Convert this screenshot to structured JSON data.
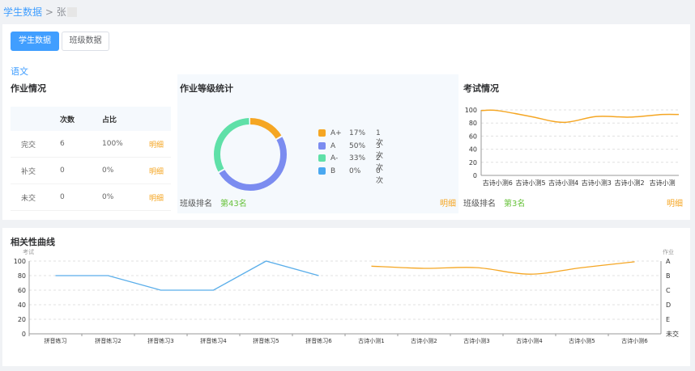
{
  "breadcrumb": {
    "parent": "学生数据",
    "separator": ">",
    "current": "张"
  },
  "tabs": {
    "student": "学生数据",
    "class": "班级数据"
  },
  "subject": "语文",
  "homework": {
    "title": "作业情况",
    "headers": [
      "",
      "次数",
      "占比",
      ""
    ],
    "rows": [
      {
        "label": "完交",
        "count": "6",
        "ratio": "100%",
        "action": "明细"
      },
      {
        "label": "补交",
        "count": "0",
        "ratio": "0%",
        "action": "明细"
      },
      {
        "label": "未交",
        "count": "0",
        "ratio": "0%",
        "action": "明细"
      }
    ]
  },
  "grades": {
    "title": "作业等级统计",
    "legend": [
      {
        "grade": "A+",
        "percent": "17%",
        "count": "1次",
        "color": "#f5a623"
      },
      {
        "grade": "A",
        "percent": "50%",
        "count": "3次",
        "color": "#7b8cf0"
      },
      {
        "grade": "A-",
        "percent": "33%",
        "count": "2次",
        "color": "#5fe0a8"
      },
      {
        "grade": "B",
        "percent": "0%",
        "count": "0次",
        "color": "#4aa8f0"
      }
    ],
    "rank_label": "班级排名",
    "rank_value": "第43名",
    "detail": "明细"
  },
  "exams": {
    "title": "考试情况",
    "rank_label": "班级排名",
    "rank_value": "第3名",
    "detail": "明细"
  },
  "correlation": {
    "title": "相关性曲线"
  },
  "chart_data": [
    {
      "type": "line",
      "title": "考试情况",
      "categories": [
        "古诗小测6",
        "古诗小测5",
        "古诗小测4",
        "古诗小测3",
        "古诗小测2",
        "古诗小测"
      ],
      "series": [
        {
          "values": [
            99,
            90,
            81,
            90,
            89,
            93
          ],
          "color": "#f5a623"
        }
      ],
      "yticks": [
        "0",
        "20",
        "40",
        "60",
        "80",
        "100"
      ],
      "ylim": [
        0,
        100
      ],
      "grid": true
    },
    {
      "type": "line",
      "title": "相关性曲线",
      "left_axis_label": "考试",
      "right_axis_label": "作业",
      "categories": [
        "拼音练习",
        "拼音练习2",
        "拼音练习3",
        "拼音练习4",
        "拼音练习5",
        "拼音练习6",
        "古诗小测1",
        "古诗小测2",
        "古诗小测3",
        "古诗小测4",
        "古诗小测5",
        "古诗小测6"
      ],
      "yticks_left": [
        "0",
        "20",
        "40",
        "60",
        "80",
        "100"
      ],
      "yticks_right": [
        "未交",
        "E",
        "D",
        "C",
        "B",
        "A"
      ],
      "ylim": [
        0,
        100
      ],
      "grid": true,
      "series": [
        {
          "axis": "right",
          "color": "#5aaeea",
          "values": [
            80,
            80,
            60,
            60,
            100,
            80,
            null,
            null,
            null,
            null,
            null,
            null
          ]
        },
        {
          "axis": "left",
          "color": "#f5a623",
          "values": [
            null,
            null,
            null,
            null,
            null,
            null,
            93,
            90,
            91,
            82,
            91,
            99
          ]
        }
      ]
    }
  ]
}
